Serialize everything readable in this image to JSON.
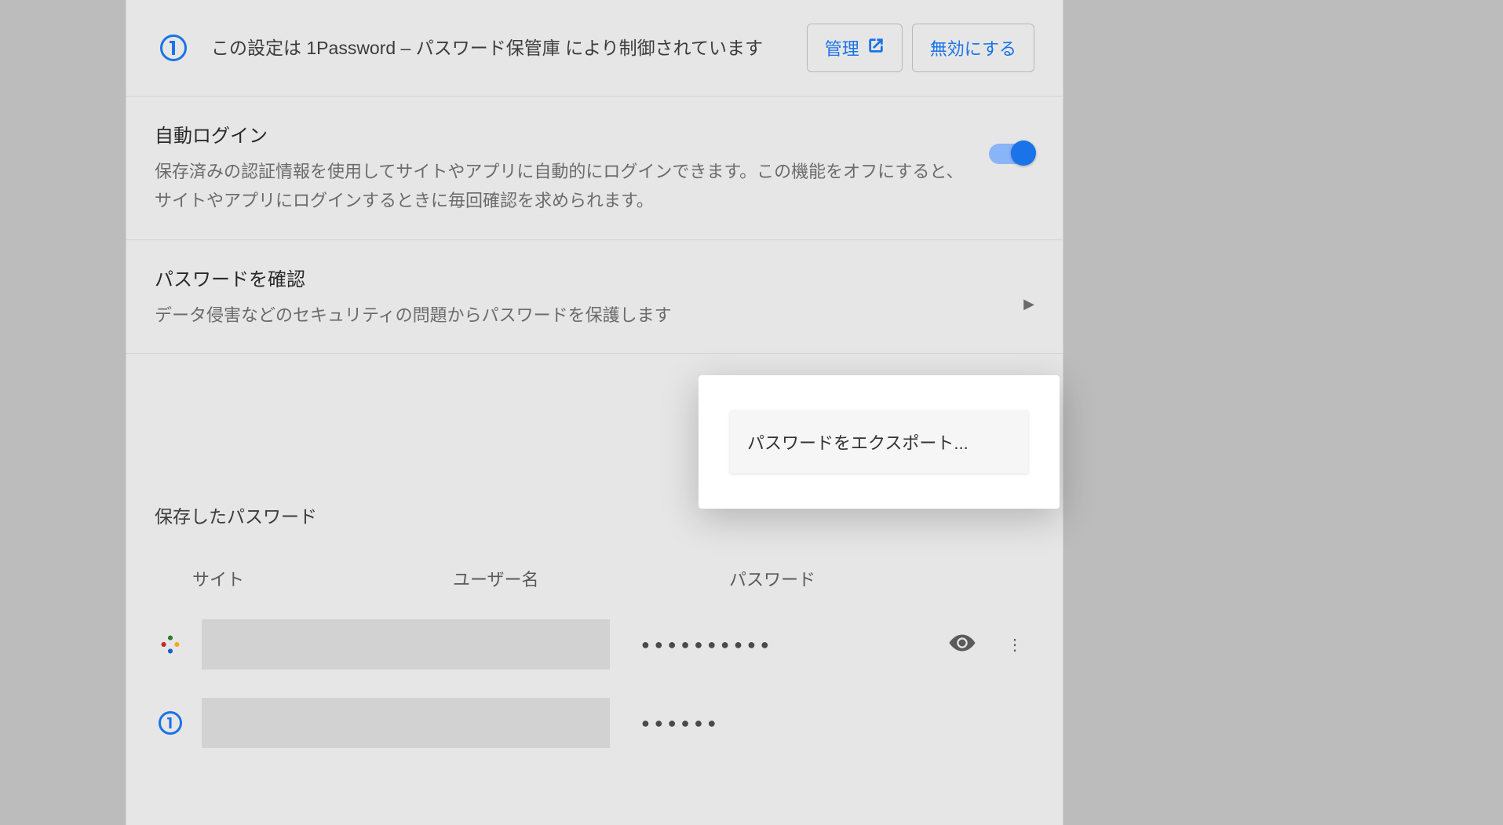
{
  "extension_banner": {
    "text": "この設定は 1Password – パスワード保管庫 により制御されています",
    "manage_label": "管理",
    "disable_label": "無効にする"
  },
  "auto_login": {
    "title": "自動ログイン",
    "description": "保存済みの認証情報を使用してサイトやアプリに自動的にログインできます。この機能をオフにすると、サイトやアプリにログインするときに毎回確認を求められます。",
    "enabled": true
  },
  "check_passwords": {
    "title": "パスワードを確認",
    "description": "データ侵害などのセキュリティの問題からパスワードを保護します"
  },
  "saved_section": {
    "title": "保存したパスワード",
    "col_site": "サイト",
    "col_user": "ユーザー名",
    "col_password": "パスワード"
  },
  "popup": {
    "export_label": "パスワードをエクスポート..."
  },
  "rows": [
    {
      "icon": "dots",
      "password_mask": "●●●●●●●●●●"
    },
    {
      "icon": "1password",
      "password_mask": "●●●●●●"
    }
  ]
}
